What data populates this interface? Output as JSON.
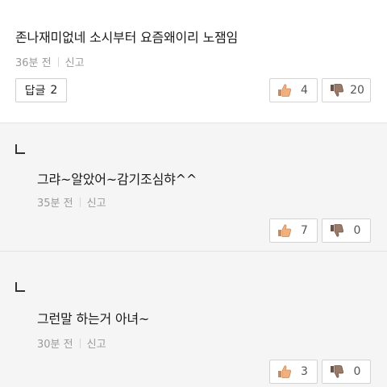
{
  "comment": {
    "text": "존나재미없네 소시부터 요즘왜이리 노잼임",
    "time": "36분 전",
    "report": "신고",
    "reply_label": "답글",
    "reply_count": "2",
    "likes": "4",
    "dislikes": "20"
  },
  "replies": [
    {
      "text": "그랴~알았어~감기조심햐^^",
      "time": "35분 전",
      "report": "신고",
      "likes": "7",
      "dislikes": "0"
    },
    {
      "text": "그런말 하는거 아녀~",
      "time": "30분 전",
      "report": "신고",
      "likes": "3",
      "dislikes": "0"
    }
  ],
  "colors": {
    "thumb_up": "#e8a070",
    "thumb_down": "#8a6a5a",
    "reply_bg": "#f5f5f5"
  },
  "icons": {
    "like": "thumbs-up-icon",
    "dislike": "thumbs-down-icon",
    "reply_marker": "reply-arrow-icon"
  }
}
